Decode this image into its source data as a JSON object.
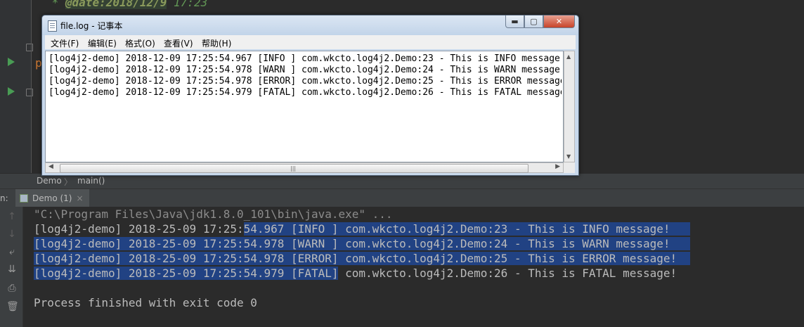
{
  "editor": {
    "comment_prefix": " * ",
    "comment_tag": "@date:2018/12/9",
    "comment_time": " 17:23",
    "code_fragment": "p"
  },
  "breadcrumb": {
    "items": [
      "Demo",
      "main()"
    ]
  },
  "run_panel": {
    "prefix": "n:",
    "tab_label": "Demo (1)",
    "tab_close": "×",
    "command": "\"C:\\Program Files\\Java\\jdk1.8.0_101\\bin\\java.exe\" ...",
    "lines": [
      {
        "a": "[log4j2-demo] 2018-25-09 17:25:",
        "b": "54.967 [INFO ] com.wkcto.log4j2.Demo:23 - This is INFO message!"
      },
      {
        "a": "[log4j2-demo] 2018-25-09 17:25:54.978 [WARN ] com.wkcto.log4j2.Demo:24 - This is WARN message!"
      },
      {
        "a": "[log4j2-demo] 2018-25-09 17:25:54.978 [ERROR] com.wkcto.log4j2.Demo:25 - This is ERROR message!"
      },
      {
        "a": "[log4j2-demo] 2018-25-09 17:25:54.979 [FATAL]",
        "b": " com.wkcto.log4j2.Demo:26 - This is FATAL message!"
      }
    ],
    "exit": "Process finished with exit code 0"
  },
  "notepad": {
    "title": "file.log - 记事本",
    "controls": {
      "minimize": "▬",
      "maximize": "▢",
      "close": "✕"
    },
    "menu": [
      "文件(F)",
      "编辑(E)",
      "格式(O)",
      "查看(V)",
      "帮助(H)"
    ],
    "lines": [
      "[log4j2-demo] 2018-12-09 17:25:54.967 [INFO ] com.wkcto.log4j2.Demo:23 - This is INFO message!",
      "[log4j2-demo] 2018-12-09 17:25:54.978 [WARN ] com.wkcto.log4j2.Demo:24 - This is WARN message!",
      "[log4j2-demo] 2018-12-09 17:25:54.978 [ERROR] com.wkcto.log4j2.Demo:25 - This is ERROR message!",
      "[log4j2-demo] 2018-12-09 17:25:54.979 [FATAL] com.wkcto.log4j2.Demo:26 - This is FATAL message!"
    ]
  },
  "colors": {
    "selection": "#214283",
    "editor_bg": "#2b2b2b",
    "run_green": "#499c54"
  }
}
